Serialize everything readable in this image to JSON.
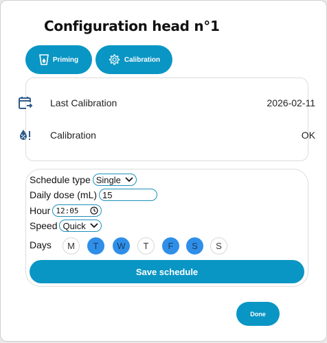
{
  "dialog": {
    "title": "Configuration head n°1"
  },
  "tabs": [
    {
      "label": "Priming",
      "icon": "cup-drop-icon"
    },
    {
      "label": "Calibration",
      "icon": "gear-icon"
    }
  ],
  "info": {
    "last_calibration": {
      "label": "Last Calibration",
      "value": "2026-02-11",
      "icon": "calendar-arrow-icon"
    },
    "calibration": {
      "label": "Calibration",
      "value": "OK",
      "icon": "drop-percent-alert-icon"
    }
  },
  "schedule": {
    "type": {
      "label": "Schedule type",
      "value": "Single"
    },
    "dose": {
      "label": "Daily dose (mL)",
      "value": "15"
    },
    "hour": {
      "label": "Hour",
      "value": "12:05"
    },
    "speed": {
      "label": "Speed",
      "value": "Quick"
    },
    "days_label": "Days",
    "days": [
      {
        "label": "M",
        "selected": false
      },
      {
        "label": "T",
        "selected": true
      },
      {
        "label": "W",
        "selected": true
      },
      {
        "label": "T",
        "selected": false
      },
      {
        "label": "F",
        "selected": true
      },
      {
        "label": "S",
        "selected": true
      },
      {
        "label": "S",
        "selected": false
      }
    ],
    "save_label": "Save schedule"
  },
  "done_label": "Done",
  "colors": {
    "accent": "#0a96c4",
    "day_selected": "#2f8fe8",
    "icon": "#2f5a8a"
  }
}
